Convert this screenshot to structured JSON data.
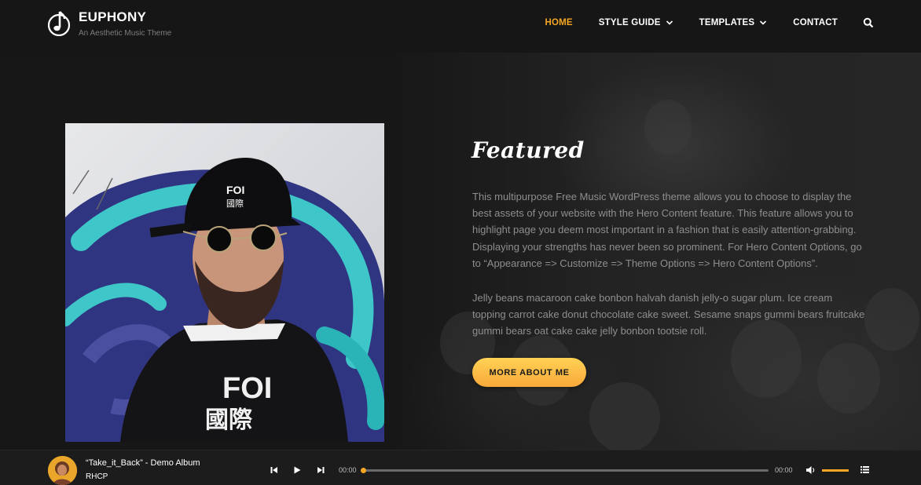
{
  "site": {
    "name": "EUPHONY",
    "tagline": "An Aesthetic Music Theme",
    "logo_icon": "music-note-icon"
  },
  "nav": {
    "items": [
      {
        "label": "HOME",
        "active": true,
        "dropdown": false
      },
      {
        "label": "STYLE GUIDE",
        "active": false,
        "dropdown": true
      },
      {
        "label": "TEMPLATES",
        "active": false,
        "dropdown": true
      },
      {
        "label": "CONTACT",
        "active": false,
        "dropdown": false
      }
    ],
    "search_icon": "search-icon",
    "active_color": "#f5a623"
  },
  "hero": {
    "title": "Featured",
    "paragraph1": "This multipurpose Free Music WordPress theme allows you to choose to display the best assets of your website with the Hero Content feature. This feature allows you to highlight page you deem most important in a fashion that is easily attention-grabbing. Displaying your strengths has never been so prominent. For Hero Content Options, go to “Appearance => Customize => Theme Options => Hero Content Options”.",
    "paragraph2": "Jelly beans macaroon cake bonbon halvah danish jelly-o sugar plum. Ice cream topping carrot cake donut chocolate cake sweet. Sesame snaps gummi bears fruitcake gummi bears oat cake cake jelly bonbon tootsie roll.",
    "button_label": "MORE ABOUT ME",
    "button_color": "#fbbf47"
  },
  "player": {
    "track_title": "“Take_it_Back” - Demo Album",
    "artist": "RHCP",
    "current_time": "00:00",
    "duration": "00:00",
    "progress": 0,
    "volume": 1.0,
    "accent": "#f5a623"
  }
}
